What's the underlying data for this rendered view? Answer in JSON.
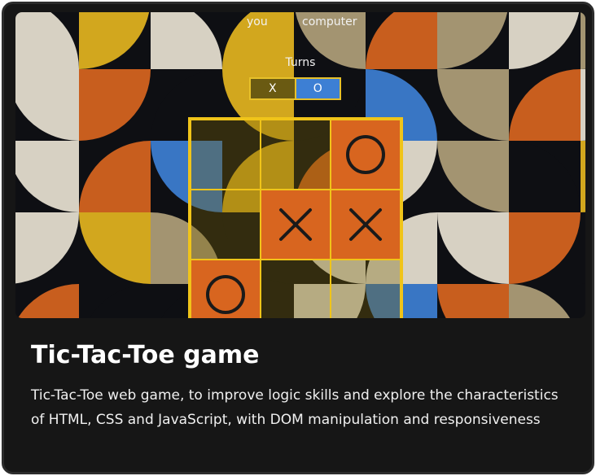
{
  "colors": {
    "card_background": "#161616",
    "board_border": "#f0c419",
    "filled_cell": "#d8651f",
    "turn_x": "#6a5a12",
    "turn_o": "#3d7fd4"
  },
  "game": {
    "score": {
      "player_label": "you",
      "opponent_label": "computer"
    },
    "turns_title": "Turns",
    "turn_x_label": "X",
    "turn_o_label": "O",
    "board": [
      [
        "",
        "",
        "O"
      ],
      [
        "",
        "X",
        "X"
      ],
      [
        "O",
        "",
        ""
      ]
    ]
  },
  "project": {
    "title": "Tic-Tac-Toe game",
    "description": "Tic-Tac-Toe web game, to improve logic skills and explore the characteristics of HTML, CSS and JavaScript, with DOM manipulation and responsiveness"
  }
}
